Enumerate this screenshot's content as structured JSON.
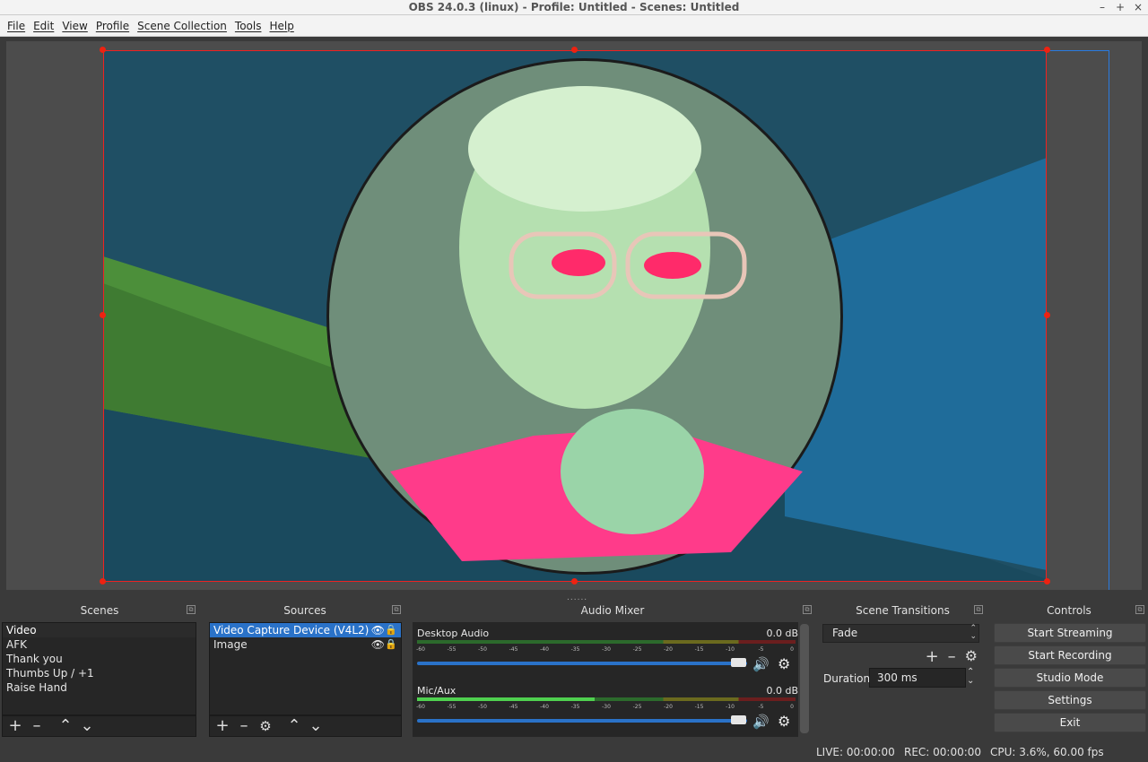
{
  "window": {
    "title": "OBS 24.0.3 (linux) - Profile: Untitled - Scenes: Untitled",
    "minimize": "–",
    "maximize": "+",
    "close": "×"
  },
  "menu": [
    "File",
    "Edit",
    "View",
    "Profile",
    "Scene Collection",
    "Tools",
    "Help"
  ],
  "scenes": {
    "title": "Scenes",
    "items": [
      "Video",
      "AFK",
      "Thank you",
      "Thumbs Up / +1",
      "Raise Hand"
    ],
    "selected": "Video"
  },
  "sources": {
    "title": "Sources",
    "items": [
      "Video Capture Device (V4L2)",
      "Image"
    ],
    "selected": "Video Capture Device (V4L2)"
  },
  "mixer": {
    "title": "Audio Mixer",
    "channels": [
      {
        "name": "Desktop Audio",
        "db": "0.0 dB",
        "level": 0
      },
      {
        "name": "Mic/Aux",
        "db": "0.0 dB",
        "level": 0.47
      }
    ],
    "ticks": [
      "-60",
      "-55",
      "-50",
      "-45",
      "-40",
      "-35",
      "-30",
      "-25",
      "-20",
      "-15",
      "-10",
      "-5",
      "0"
    ]
  },
  "transitions": {
    "title": "Scene Transitions",
    "selected": "Fade",
    "duration_label": "Duration",
    "duration_value": "300 ms"
  },
  "controls": {
    "title": "Controls",
    "buttons": [
      "Start Streaming",
      "Start Recording",
      "Studio Mode",
      "Settings",
      "Exit"
    ]
  },
  "status": {
    "live": "LIVE: 00:00:00",
    "rec": "REC: 00:00:00",
    "cpu": "CPU: 3.6%, 60.00 fps"
  },
  "colors": {
    "selection": "#2a72c8",
    "bounding_box": "#e22222",
    "canvas_bg": "#1f4f64"
  },
  "icons": [
    "add-icon",
    "remove-icon",
    "move-up-icon",
    "move-down-icon",
    "gear-icon",
    "eye-icon",
    "lock-icon",
    "speaker-icon"
  ]
}
